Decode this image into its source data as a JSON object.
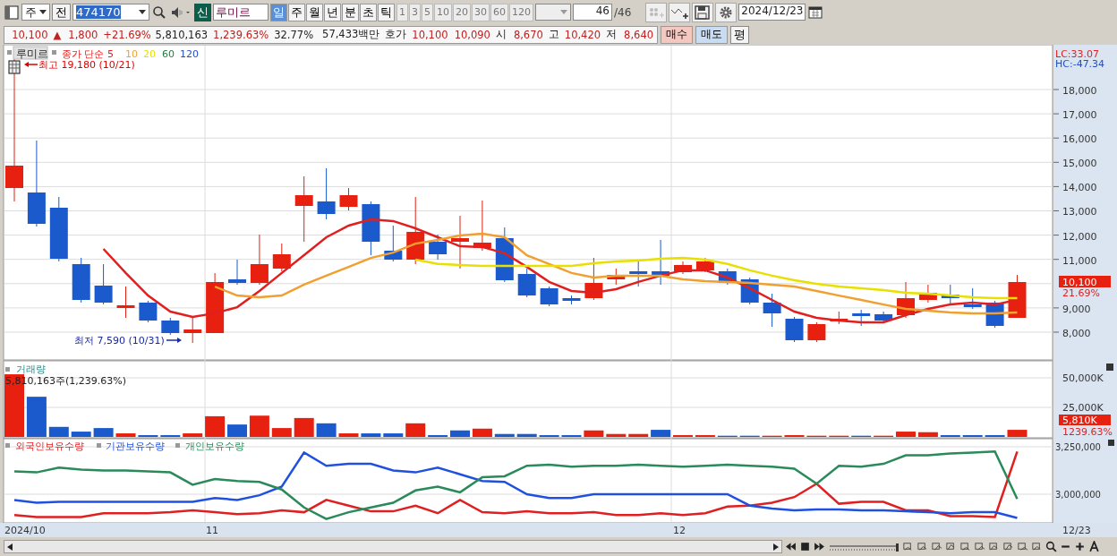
{
  "toolbar": {
    "market": "주",
    "prefix": "전",
    "code": "474170",
    "badge": "신",
    "stock_name": "루미르",
    "periods": [
      {
        "label": "일",
        "selected": true
      },
      {
        "label": "주",
        "selected": false
      },
      {
        "label": "월",
        "selected": false
      },
      {
        "label": "년",
        "selected": false
      },
      {
        "label": "분",
        "selected": false
      },
      {
        "label": "초",
        "selected": false
      },
      {
        "label": "틱",
        "selected": false
      }
    ],
    "intervals": [
      "1",
      "3",
      "5",
      "10",
      "20",
      "30",
      "60",
      "120"
    ],
    "count": "46",
    "count_total": "/46",
    "date": "2024/12/23"
  },
  "quote": {
    "price": "10,100",
    "arrow": "▲",
    "change": "1,800",
    "change_pct": "+21.69%",
    "volume": "5,810,163",
    "volume_pct": "1,239.63%",
    "turnover": "32.77%",
    "amount": "57,433백만",
    "bid_label": "호가",
    "ask": "10,100",
    "bid": "10,090",
    "open_label": "시",
    "open": "8,670",
    "high_label": "고",
    "high": "10,420",
    "low_label": "저",
    "low": "8,640",
    "buy": "매수",
    "sell": "매도",
    "eval": "평"
  },
  "price_panel": {
    "name": "루미르",
    "ma_legend_extra": [
      {
        "label": "60",
        "color": "#208040"
      },
      {
        "label": "120",
        "color": "#2050c0"
      }
    ],
    "high_note": "최고 19,180 (10/21)",
    "low_note": "최저 7,590 (10/31)",
    "lc": "LC:33.07",
    "hc": "HC:-47.34",
    "last_price": "10,100",
    "last_pct": "21.69%",
    "chart_data": {
      "type": "line",
      "ylim": [
        6856,
        19845
      ],
      "yticks": [
        {
          "value": 18000,
          "label": "18,000"
        },
        {
          "value": 17000,
          "label": "17,000"
        },
        {
          "value": 16000,
          "label": "16,000"
        },
        {
          "value": 15000,
          "label": "15,000"
        },
        {
          "value": 14000,
          "label": "14,000"
        },
        {
          "value": 13000,
          "label": "13,000"
        },
        {
          "value": 12000,
          "label": "12,000"
        },
        {
          "value": 11000,
          "label": "11,000"
        },
        {
          "value": 9000,
          "label": "9,000"
        },
        {
          "value": 8000,
          "label": "8,000"
        }
      ],
      "series": [
        {
          "name": "종가 단순 5",
          "color": "#e02020",
          "values": [
            null,
            null,
            null,
            null,
            11430,
            10440,
            9510,
            8850,
            8630,
            8780,
            9030,
            9700,
            10440,
            11170,
            11910,
            12390,
            12650,
            12580,
            12280,
            11910,
            11540,
            11510,
            11250,
            10690,
            10070,
            9700,
            9620,
            9770,
            10070,
            10330,
            10550,
            10550,
            10250,
            9810,
            9330,
            8850,
            8590,
            8480,
            8410,
            8410,
            8700,
            8960,
            9140,
            9220,
            9140,
            9330
          ]
        },
        {
          "name": "10",
          "color": "#f0a030",
          "values": [
            null,
            null,
            null,
            null,
            null,
            null,
            null,
            null,
            null,
            9880,
            9510,
            9440,
            9510,
            9960,
            10330,
            10690,
            11060,
            11280,
            11650,
            11800,
            11990,
            12060,
            11910,
            11170,
            10810,
            10440,
            10250,
            10330,
            10330,
            10330,
            10180,
            10100,
            10070,
            10030,
            9960,
            9880,
            9700,
            9510,
            9330,
            9140,
            8960,
            8890,
            8810,
            8780,
            8780,
            8810
          ]
        },
        {
          "name": "20",
          "color": "#e8e000",
          "values": [
            null,
            null,
            null,
            null,
            null,
            null,
            null,
            null,
            null,
            null,
            null,
            null,
            null,
            null,
            null,
            null,
            null,
            null,
            10990,
            10810,
            10770,
            10730,
            10730,
            10730,
            10730,
            10730,
            10840,
            10920,
            10950,
            11030,
            11060,
            10990,
            10810,
            10550,
            10330,
            10140,
            9990,
            9880,
            9810,
            9730,
            9620,
            9590,
            9510,
            9440,
            9400,
            9400
          ]
        }
      ]
    }
  },
  "volume_panel": {
    "title": "거래량",
    "note": "5,810,163주(1,239.63%)",
    "last": "5,810K",
    "last_pct": "1239.63%",
    "chart_data": {
      "type": "bar",
      "ylim": [
        0,
        64400
      ],
      "yticks": [
        {
          "value": 50000,
          "label": "50,000K"
        },
        {
          "value": 25000,
          "label": "25,000K"
        }
      ],
      "series": [
        {
          "color": "#e8200f",
          "values": [
            53000,
            null,
            null,
            null,
            null,
            3000,
            null,
            null,
            3000,
            17500,
            null,
            18000,
            7500,
            16000,
            null,
            3000,
            null,
            null,
            11500,
            null,
            null,
            7000,
            null,
            null,
            null,
            null,
            5500,
            2500,
            2500,
            null,
            1500,
            1500,
            null,
            null,
            1000,
            1500,
            1000,
            1000,
            null,
            1000,
            4500,
            4000,
            null,
            null,
            null,
            6000
          ]
        },
        {
          "color": "#1a5acc",
          "values": [
            null,
            34000,
            8500,
            4500,
            7500,
            null,
            1500,
            1500,
            null,
            null,
            10500,
            null,
            null,
            null,
            11500,
            null,
            3000,
            3000,
            null,
            1500,
            5500,
            null,
            2500,
            2500,
            1500,
            1500,
            null,
            null,
            null,
            6000,
            null,
            null,
            1000,
            1000,
            null,
            null,
            null,
            null,
            1000,
            null,
            null,
            null,
            1500,
            1500,
            1500,
            null
          ]
        }
      ]
    }
  },
  "holdings_panel": {
    "chart_data": {
      "type": "line",
      "ylim": [
        2849100,
        3292500
      ],
      "yticks": [
        {
          "value": 3250000,
          "label": "3,250,000"
        },
        {
          "value": 3000000,
          "label": "3,000,000"
        }
      ],
      "series": [
        {
          "name": "외국인보유수량",
          "color": "#e02020",
          "values": [
            2890000,
            2880000,
            2880000,
            2880000,
            2900000,
            2900000,
            2900000,
            2905000,
            2915000,
            2905000,
            2895000,
            2900000,
            2915000,
            2905000,
            2970000,
            2940000,
            2910000,
            2910000,
            2940000,
            2900000,
            2970000,
            2905000,
            2900000,
            2910000,
            2900000,
            2900000,
            2905000,
            2890000,
            2890000,
            2900000,
            2890000,
            2900000,
            2935000,
            2940000,
            2955000,
            2985000,
            3055000,
            2950000,
            2960000,
            2960000,
            2915000,
            2915000,
            2885000,
            2885000,
            2880000,
            3225000
          ]
        },
        {
          "name": "기관보유수량",
          "color": "#2050e0",
          "values": [
            2970000,
            2955000,
            2960000,
            2960000,
            2960000,
            2960000,
            2960000,
            2960000,
            2960000,
            2980000,
            2970000,
            2995000,
            3040000,
            3220000,
            3150000,
            3160000,
            3160000,
            3125000,
            3115000,
            3140000,
            3105000,
            3070000,
            3065000,
            3000000,
            2980000,
            2980000,
            3000000,
            3000000,
            3000000,
            3000000,
            3000000,
            3000000,
            3000000,
            2940000,
            2925000,
            2915000,
            2920000,
            2920000,
            2915000,
            2915000,
            2910000,
            2905000,
            2900000,
            2905000,
            2905000,
            2875000
          ]
        },
        {
          "name": "개인보유수량",
          "color": "#2a8a5a",
          "values": [
            3120000,
            3115000,
            3140000,
            3130000,
            3125000,
            3125000,
            3120000,
            3115000,
            3050000,
            3080000,
            3070000,
            3065000,
            3025000,
            2930000,
            2870000,
            2905000,
            2930000,
            2955000,
            3020000,
            3040000,
            3010000,
            3090000,
            3095000,
            3150000,
            3155000,
            3145000,
            3150000,
            3150000,
            3155000,
            3150000,
            3145000,
            3150000,
            3155000,
            3150000,
            3145000,
            3135000,
            3055000,
            3150000,
            3145000,
            3160000,
            3205000,
            3205000,
            3215000,
            3220000,
            3225000,
            2975000
          ]
        }
      ]
    }
  },
  "x_axis": {
    "labels": [
      "2024/10",
      "11",
      "12"
    ],
    "last_date": "12/23"
  },
  "zoom": {
    "level": 1
  }
}
